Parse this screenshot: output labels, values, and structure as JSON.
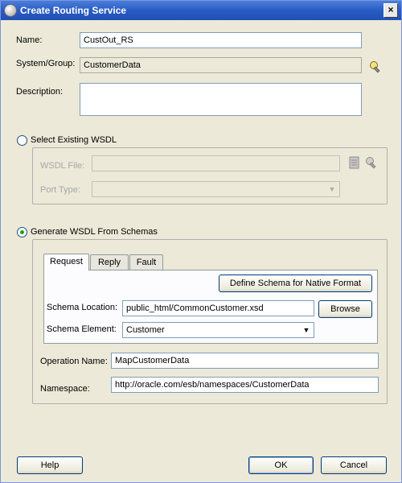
{
  "window": {
    "title": "Create Routing Service"
  },
  "form": {
    "name_label": "Name:",
    "name_value": "CustOut_RS",
    "system_label": "System/Group:",
    "system_value": "CustomerData",
    "description_label": "Description:",
    "description_value": ""
  },
  "existing_wsdl": {
    "radio_label": "Select Existing WSDL",
    "selected": false,
    "wsdl_file_label": "WSDL File:",
    "wsdl_file_value": "",
    "port_type_label": "Port Type:",
    "port_type_value": ""
  },
  "generate_wsdl": {
    "radio_label": "Generate WSDL From Schemas",
    "selected": true,
    "tabs": [
      {
        "label": "Request",
        "active": true
      },
      {
        "label": "Reply",
        "active": false
      },
      {
        "label": "Fault",
        "active": false
      }
    ],
    "define_schema_button": "Define Schema for Native Format",
    "schema_location_label": "Schema Location:",
    "schema_location_value": "public_html/CommonCustomer.xsd",
    "browse_button": "Browse",
    "schema_element_label": "Schema Element:",
    "schema_element_value": "Customer",
    "operation_name_label": "Operation Name:",
    "operation_name_value": "MapCustomerData",
    "namespace_label": "Namespace:",
    "namespace_value": "http://oracle.com/esb/namespaces/CustomerData"
  },
  "footer": {
    "help_button": "Help",
    "ok_button": "OK",
    "cancel_button": "Cancel"
  },
  "colors": {
    "titlebar": "#2a5cc4",
    "dialog_bg": "#ece9d8",
    "radio_dot": "#21a121"
  },
  "icons": {
    "app": "oracle-jdeveloper-icon",
    "flashlight": "flashlight-icon",
    "browse_wsdl": "document-icon",
    "service_explorer": "flashlight-icon"
  }
}
